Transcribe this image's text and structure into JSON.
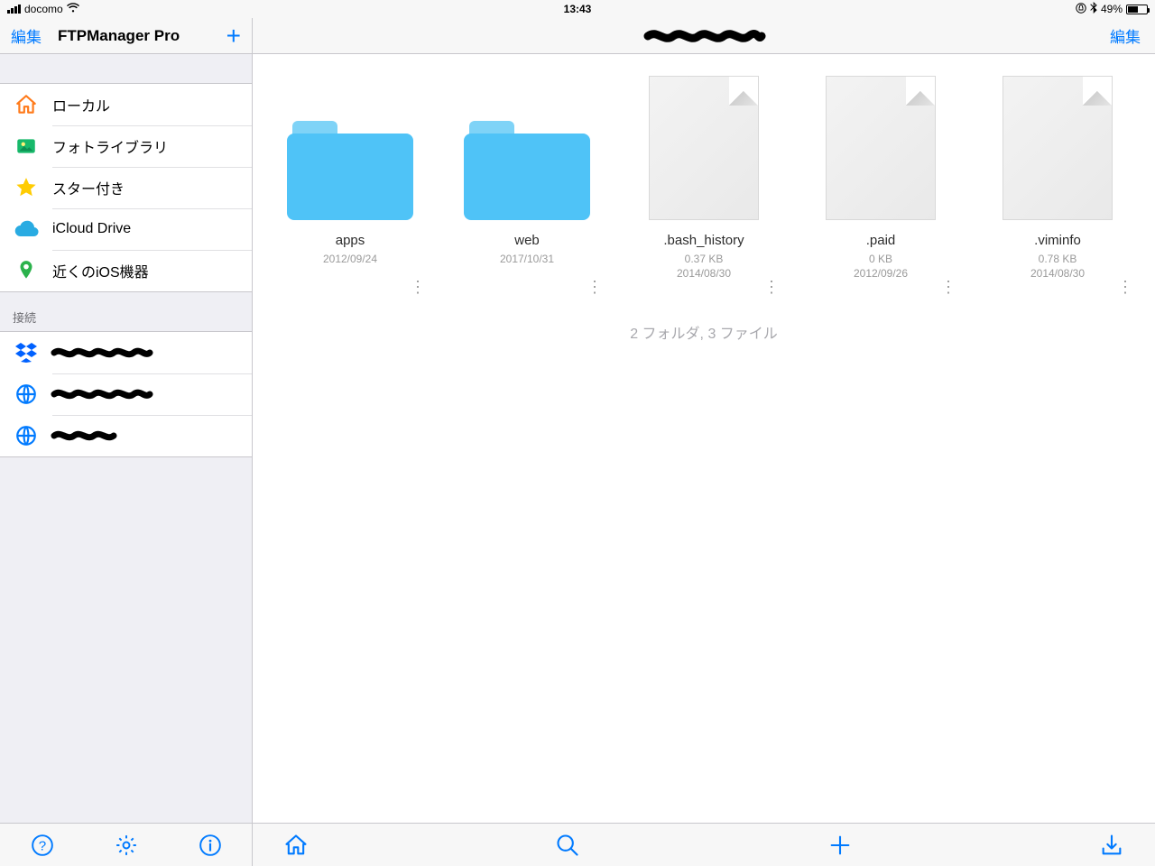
{
  "status": {
    "carrier": "docomo",
    "time": "13:43",
    "battery_pct": "49%"
  },
  "sidebar": {
    "edit_label": "編集",
    "title": "FTPManager Pro",
    "items": {
      "local": "ローカル",
      "photo": "フォトライブラリ",
      "star": "スター付き",
      "icloud": "iCloud Drive",
      "nearby": "近くのiOS機器"
    },
    "section_connections": "接続"
  },
  "main": {
    "edit_label": "編集",
    "summary": "2 フォルダ, 3 ファイル",
    "files": [
      {
        "name": "apps",
        "size": "",
        "date": "2012/09/24",
        "type": "folder"
      },
      {
        "name": "web",
        "size": "",
        "date": "2017/10/31",
        "type": "folder"
      },
      {
        "name": ".bash_history",
        "size": "0.37 KB",
        "date": "2014/08/30",
        "type": "file"
      },
      {
        "name": ".paid",
        "size": "0 KB",
        "date": "2012/09/26",
        "type": "file"
      },
      {
        "name": ".viminfo",
        "size": "0.78 KB",
        "date": "2014/08/30",
        "type": "file"
      }
    ]
  }
}
